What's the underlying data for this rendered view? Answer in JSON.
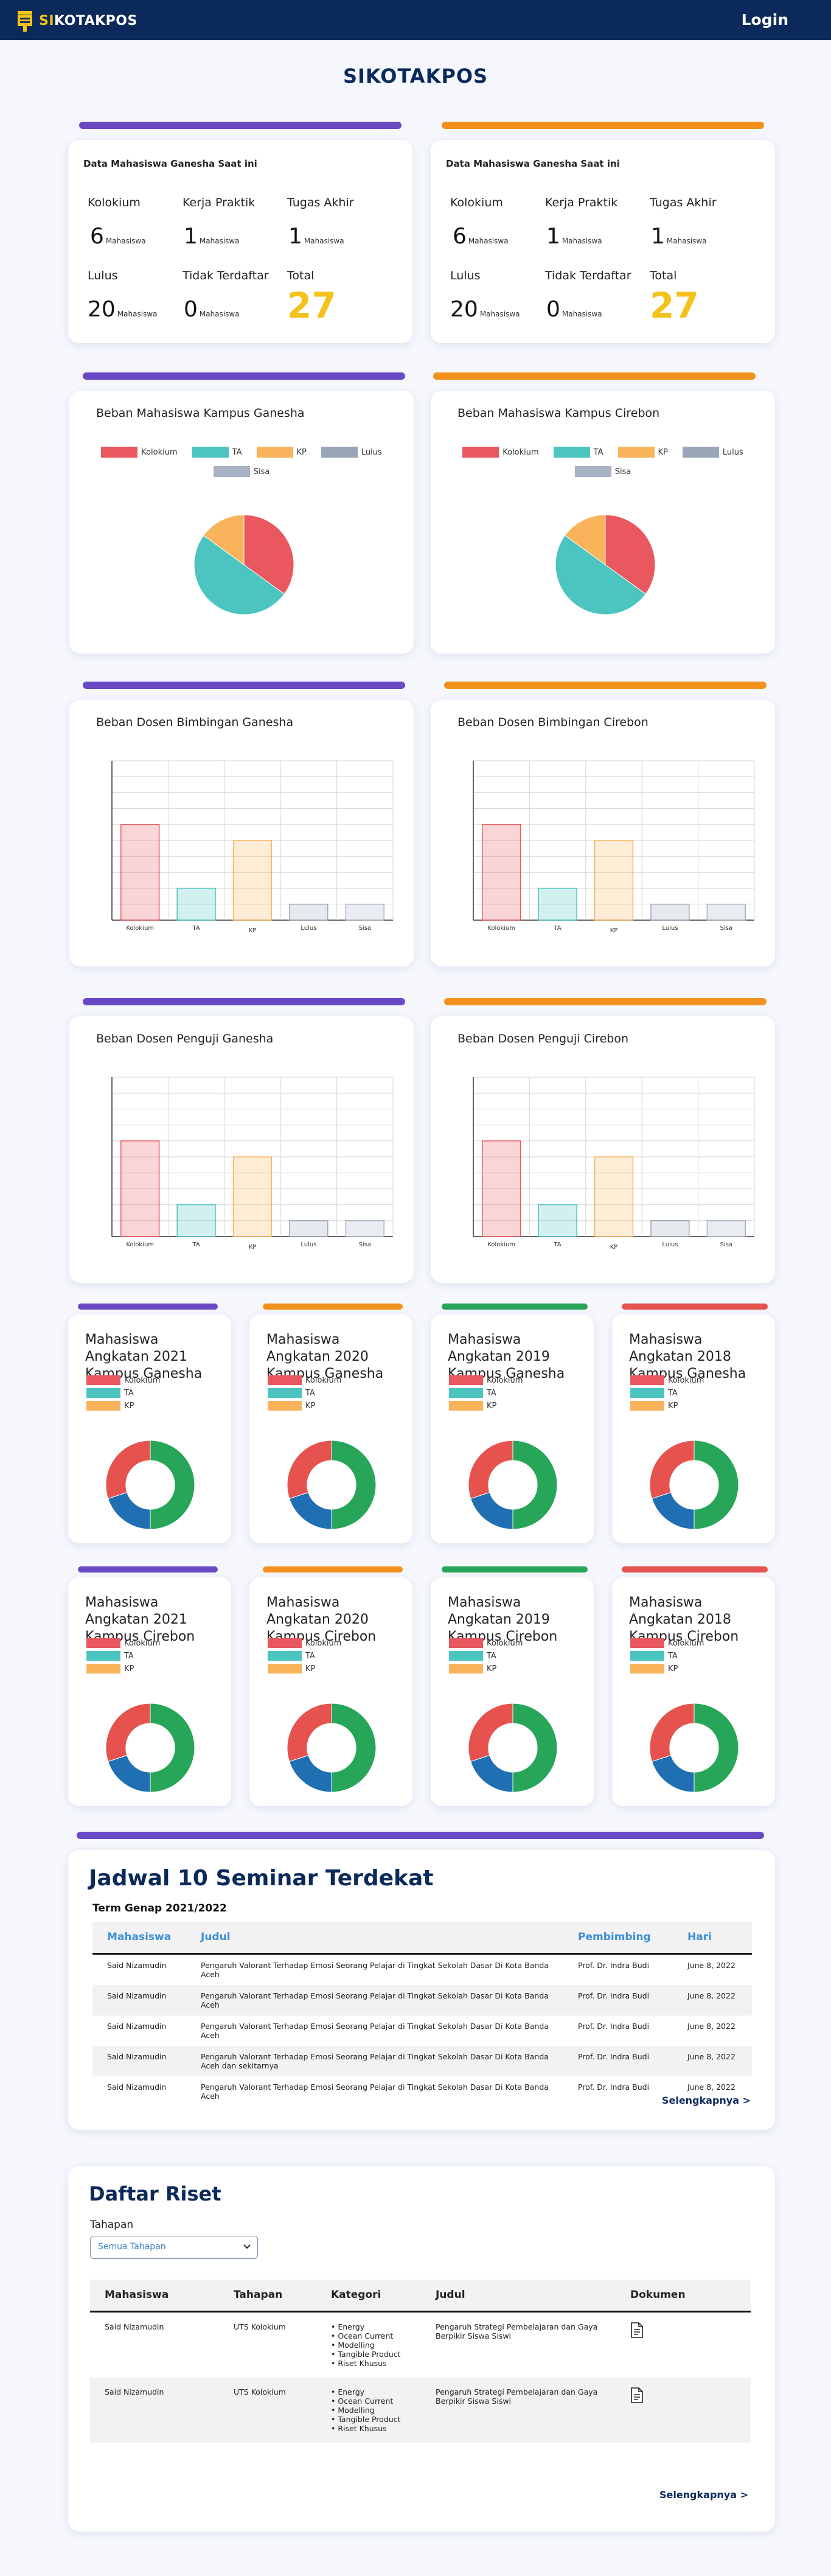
{
  "navbar": {
    "brand_prefix": "SI",
    "brand_main": "KOTAKPOS",
    "login": "Login"
  },
  "page_title": "SIKOTAKPOS",
  "data_cards": [
    {
      "heading": "Data Mahasiswa Ganesha Saat ini",
      "labels": {
        "kolokium": "Kolokium",
        "kp": "Kerja Praktik",
        "ta": "Tugas Akhir",
        "lulus": "Lulus",
        "tidak": "Tidak Terdaftar",
        "total": "Total"
      },
      "values": {
        "kolokium": "6",
        "kp": "1",
        "ta": "1",
        "lulus": "20",
        "tidak": "0",
        "total": "27"
      },
      "unit": "Mahasiswa"
    },
    {
      "heading": "Data Mahasiswa Ganesha Saat ini",
      "labels": {
        "kolokium": "Kolokium",
        "kp": "Kerja Praktik",
        "ta": "Tugas Akhir",
        "lulus": "Lulus",
        "tidak": "Tidak Terdaftar",
        "total": "Total"
      },
      "values": {
        "kolokium": "6",
        "kp": "1",
        "ta": "1",
        "lulus": "20",
        "tidak": "0",
        "total": "27"
      },
      "unit": "Mahasiswa"
    }
  ],
  "legend_labels": {
    "kolokium": "Kolokium",
    "ta": "TA",
    "kp": "KP",
    "lulus": "Lulus",
    "sisa": "Sisa"
  },
  "colors": {
    "kolokium": "#e8585e",
    "ta": "#4cc4c0",
    "kp": "#f9b45b",
    "lulus": "#9aa6b8",
    "sisa": "#a8b2c4",
    "donut_green": "#27a558",
    "donut_blue": "#1f6fb2",
    "donut_red": "#e6524e"
  },
  "chart_data": [
    {
      "id": "pie-ganesha",
      "type": "pie",
      "title": "Beban Mahasiswa Kampus Ganesha",
      "categories": [
        "Kolokium",
        "TA",
        "KP",
        "Lulus",
        "Sisa"
      ],
      "values": [
        35,
        50,
        15,
        0,
        0
      ]
    },
    {
      "id": "pie-cirebon",
      "type": "pie",
      "title": "Beban Mahasiswa Kampus Cirebon",
      "categories": [
        "Kolokium",
        "TA",
        "KP",
        "Lulus",
        "Sisa"
      ],
      "values": [
        35,
        50,
        15,
        0,
        0
      ]
    },
    {
      "id": "bar-dosen-bimbingan-ganesha",
      "type": "bar",
      "title": "Beban Dosen Bimbingan Ganesha",
      "categories": [
        "Kolokium",
        "TA",
        "KP",
        "Lulus",
        "Sisa"
      ],
      "values": [
        6,
        2,
        5,
        1,
        1
      ],
      "ylim": [
        0,
        10
      ]
    },
    {
      "id": "bar-dosen-bimbingan-cirebon",
      "type": "bar",
      "title": "Beban Dosen Bimbingan Cirebon",
      "categories": [
        "Kolokium",
        "TA",
        "KP",
        "Lulus",
        "Sisa"
      ],
      "values": [
        6,
        2,
        5,
        1,
        1
      ],
      "ylim": [
        0,
        10
      ]
    },
    {
      "id": "bar-dosen-penguji-ganesha",
      "type": "bar",
      "title": "Beban Dosen Penguji Ganesha",
      "categories": [
        "Kolokium",
        "TA",
        "KP",
        "Lulus",
        "Sisa"
      ],
      "values": [
        6,
        2,
        5,
        1,
        1
      ],
      "ylim": [
        0,
        10
      ]
    },
    {
      "id": "bar-dosen-penguji-cirebon",
      "type": "bar",
      "title": "Beban Dosen Penguji Cirebon",
      "categories": [
        "Kolokium",
        "TA",
        "KP",
        "Lulus",
        "Sisa"
      ],
      "values": [
        6,
        2,
        5,
        1,
        1
      ],
      "ylim": [
        0,
        10
      ]
    },
    {
      "id": "donut-2021-ganesha",
      "type": "pie",
      "title": "Mahasiswa Angkatan 2021 Kampus Ganesha",
      "categories": [
        "Kolokium",
        "TA",
        "KP"
      ],
      "values": [
        50,
        20,
        30
      ]
    },
    {
      "id": "donut-2020-ganesha",
      "type": "pie",
      "title": "Mahasiswa Angkatan 2020 Kampus Ganesha",
      "categories": [
        "Kolokium",
        "TA",
        "KP"
      ],
      "values": [
        50,
        20,
        30
      ]
    },
    {
      "id": "donut-2019-ganesha",
      "type": "pie",
      "title": "Mahasiswa Angkatan 2019 Kampus Ganesha",
      "categories": [
        "Kolokium",
        "TA",
        "KP"
      ],
      "values": [
        50,
        20,
        30
      ]
    },
    {
      "id": "donut-2018-ganesha",
      "type": "pie",
      "title": "Mahasiswa Angkatan 2018 Kampus Ganesha",
      "categories": [
        "Kolokium",
        "TA",
        "KP"
      ],
      "values": [
        50,
        20,
        30
      ]
    },
    {
      "id": "donut-2021-cirebon",
      "type": "pie",
      "title": "Mahasiswa Angkatan 2021 Kampus Cirebon",
      "categories": [
        "Kolokium",
        "TA",
        "KP"
      ],
      "values": [
        50,
        20,
        30
      ]
    },
    {
      "id": "donut-2020-cirebon",
      "type": "pie",
      "title": "Mahasiswa Angkatan 2020 Kampus Cirebon",
      "categories": [
        "Kolokium",
        "TA",
        "KP"
      ],
      "values": [
        50,
        20,
        30
      ]
    },
    {
      "id": "donut-2019-cirebon",
      "type": "pie",
      "title": "Mahasiswa Angkatan 2019 Kampus Cirebon",
      "categories": [
        "Kolokium",
        "TA",
        "KP"
      ],
      "values": [
        50,
        20,
        30
      ]
    },
    {
      "id": "donut-2018-cirebon",
      "type": "pie",
      "title": "Mahasiswa Angkatan 2018 Kampus Cirebon",
      "categories": [
        "Kolokium",
        "TA",
        "KP"
      ],
      "values": [
        50,
        20,
        30
      ]
    }
  ],
  "seminar": {
    "heading": "Jadwal 10 Seminar Terdekat",
    "term": "Term Genap 2021/2022",
    "columns": [
      "Mahasiswa",
      "Judul",
      "Pembimbing",
      "Hari"
    ],
    "rows": [
      [
        "Said Nizamudin",
        "Pengaruh Valorant Terhadap Emosi Seorang Pelajar di Tingkat Sekolah Dasar Di Kota Banda Aceh",
        "Prof. Dr. Indra Budi",
        "June 8, 2022"
      ],
      [
        "Said Nizamudin",
        "Pengaruh Valorant Terhadap Emosi Seorang Pelajar di Tingkat Sekolah Dasar Di Kota Banda Aceh",
        "Prof. Dr. Indra Budi",
        "June 8, 2022"
      ],
      [
        "Said Nizamudin",
        "Pengaruh Valorant Terhadap Emosi Seorang Pelajar di Tingkat Sekolah Dasar Di Kota Banda Aceh",
        "Prof. Dr. Indra Budi",
        "June 8, 2022"
      ],
      [
        "Said Nizamudin",
        "Pengaruh Valorant Terhadap Emosi Seorang Pelajar di Tingkat Sekolah Dasar Di Kota Banda Aceh dan sekitarnya",
        "Prof. Dr. Indra Budi",
        "June 8, 2022"
      ],
      [
        "Said Nizamudin",
        "Pengaruh Valorant Terhadap Emosi Seorang Pelajar di Tingkat Sekolah Dasar Di Kota Banda Aceh",
        "Prof. Dr. Indra Budi",
        "June 8, 2022"
      ]
    ],
    "more": "Selengkapnya >"
  },
  "riset": {
    "heading": "Daftar Riset",
    "filter_label": "Tahapan",
    "filter_value": "Semua Tahapan",
    "columns": [
      "Mahasiswa",
      "Tahapan",
      "Kategori",
      "Judul",
      "Dokumen"
    ],
    "rows": [
      {
        "mahasiswa": "Said Nizamudin",
        "tahapan": "UTS Kolokium",
        "kategori": [
          "Energy",
          "Ocean Current",
          "Modelling",
          "Tangible Product",
          "Riset Khusus"
        ],
        "judul": "Pengaruh Strategi Pembelajaran dan Gaya Berpikir Siswa Siswi"
      },
      {
        "mahasiswa": "Said Nizamudin",
        "tahapan": "UTS Kolokium",
        "kategori": [
          "Energy",
          "Ocean Current",
          "Modelling",
          "Tangible Product",
          "Riset Khusus"
        ],
        "judul": "Pengaruh Strategi Pembelajaran dan Gaya Berpikir Siswa Siswi"
      }
    ],
    "more": "Selengkapnya >"
  }
}
